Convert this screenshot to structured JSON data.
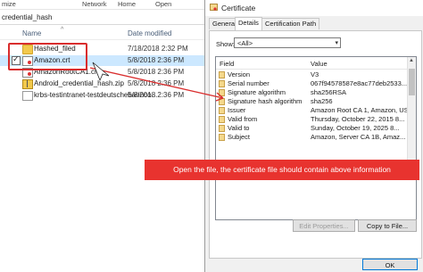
{
  "explorer": {
    "topbar": {
      "view_label": "mize",
      "network": "Network",
      "home": "Home",
      "open": "Open"
    },
    "address_text": "credential_hash",
    "columns": {
      "name": "Name",
      "date": "Date modified"
    },
    "files": [
      {
        "name": "Hashed_filed",
        "date": "7/18/2018 2:32 PM",
        "icon": "folder-icon"
      },
      {
        "name": "Amazon.crt",
        "date": "5/8/2018 2:36 PM",
        "icon": "certificate-icon"
      },
      {
        "name": "AmazonRootCA1.crt",
        "date": "5/8/2018 2:36 PM",
        "icon": "certificate-icon"
      },
      {
        "name": "Android_credential_hash.zip",
        "date": "5/8/2018 2:36 PM",
        "icon": "zip-icon"
      },
      {
        "name": "krbs-testintranet-testdeutschebahnco...",
        "date": "5/8/2018 2:36 PM",
        "icon": "text-file-icon"
      }
    ]
  },
  "dialog": {
    "title": "Certificate",
    "tabs": [
      "General",
      "Details",
      "Certification Path"
    ],
    "show_label": "Show:",
    "show_value": "<All>",
    "list_header": {
      "field": "Field",
      "value": "Value"
    },
    "fields": [
      {
        "field": "Version",
        "value": "V3"
      },
      {
        "field": "Serial number",
        "value": "067f94578587e8ac77deb2533..."
      },
      {
        "field": "Signature algorithm",
        "value": "sha256RSA"
      },
      {
        "field": "Signature hash algorithm",
        "value": "sha256"
      },
      {
        "field": "Issuer",
        "value": "Amazon Root CA 1, Amazon, US"
      },
      {
        "field": "Valid from",
        "value": "Thursday, October 22, 2015 8..."
      },
      {
        "field": "Valid to",
        "value": "Sunday, October 19, 2025 8..."
      },
      {
        "field": "Subject",
        "value": "Amazon, Server CA 1B, Amaz..."
      }
    ],
    "buttons": {
      "edit_properties": "Edit Properties...",
      "copy_to_file": "Copy to File...",
      "ok": "OK"
    }
  },
  "annotation": "Open the file, the certificate file should contain above information",
  "colors": {
    "highlight": "#d92d2d",
    "banner": "#e8332f",
    "selection": "#cce8ff"
  }
}
